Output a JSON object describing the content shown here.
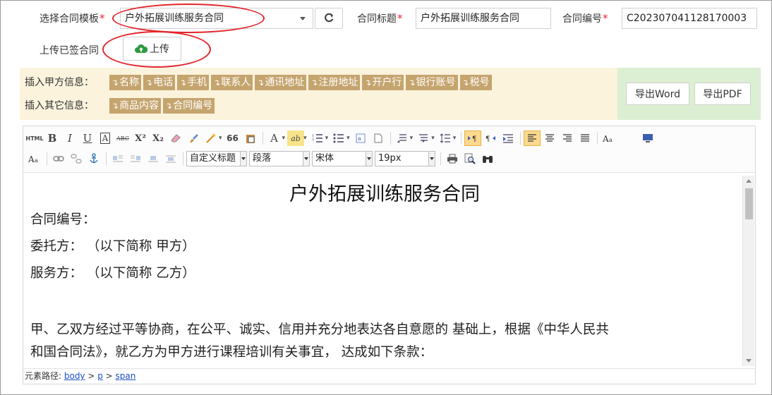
{
  "form": {
    "template_label": "选择合同模板",
    "template_value": "户外拓展训练服务合同",
    "title_label": "合同标题",
    "title_value": "户外拓展训练服务合同",
    "number_label": "合同编号",
    "number_value": "C202307041128170003",
    "required_mark": "*",
    "upload_label": "上传已签合同",
    "upload_button": "上传"
  },
  "insert_bar": {
    "party_a_label": "插入甲方信息：",
    "party_a_tags": [
      "名称",
      "电话",
      "手机",
      "联系人",
      "通讯地址",
      "注册地址",
      "开户行",
      "银行账号",
      "税号"
    ],
    "other_label": "插入其它信息：",
    "other_tags": [
      "商品内容",
      "合同编号"
    ],
    "tag_arrow": "↴"
  },
  "export": {
    "word_button": "导出Word",
    "pdf_button": "导出PDF"
  },
  "toolbar": {
    "html_label": "HTML",
    "bold": "B",
    "italic": "I",
    "underline": "U",
    "font_border": "A",
    "strike": "ABC",
    "superscript": "X²",
    "subscript": "X₂",
    "blockquote": "66",
    "font_color": "A",
    "highlight": "ab",
    "heading_combo": "自定义标题",
    "paragraph_combo": "段落",
    "font_combo": "宋体",
    "size_combo": "19px"
  },
  "document": {
    "title": "户外拓展训练服务合同",
    "lines": [
      "合同编号：",
      "委托方：     （以下简称  甲方）",
      "服务方：     （以下简称  乙方）",
      "甲、乙双方经过平等协商，在公平、诚实、信用并充分地表达各自意愿的  基础上，根据《中华人民共",
      "和国合同法》，就乙方为甲方进行课程培训有关事宜，   达成如下条款："
    ]
  },
  "statusbar": {
    "label": "元素路径: ",
    "path": [
      "body",
      "p",
      "span"
    ],
    "separator": " > "
  },
  "colors": {
    "required": "#e23333",
    "annotation_oval": "#e3262b",
    "insert_bar_bg": "#fbf3dc",
    "tag_bg": "#c5a46e",
    "export_bar_bg": "#dcefd2",
    "upload_icon": "#2e9a3e"
  },
  "icons": [
    "refresh-icon",
    "cloud-upload-icon",
    "eraser-icon",
    "format-brush-icon",
    "magic-icon",
    "paste-text-icon",
    "list-ordered-icon",
    "list-unordered-icon",
    "link-icon",
    "unlink-icon",
    "anchor-icon",
    "print-icon",
    "preview-icon",
    "find-icon",
    "fullscreen-icon"
  ]
}
